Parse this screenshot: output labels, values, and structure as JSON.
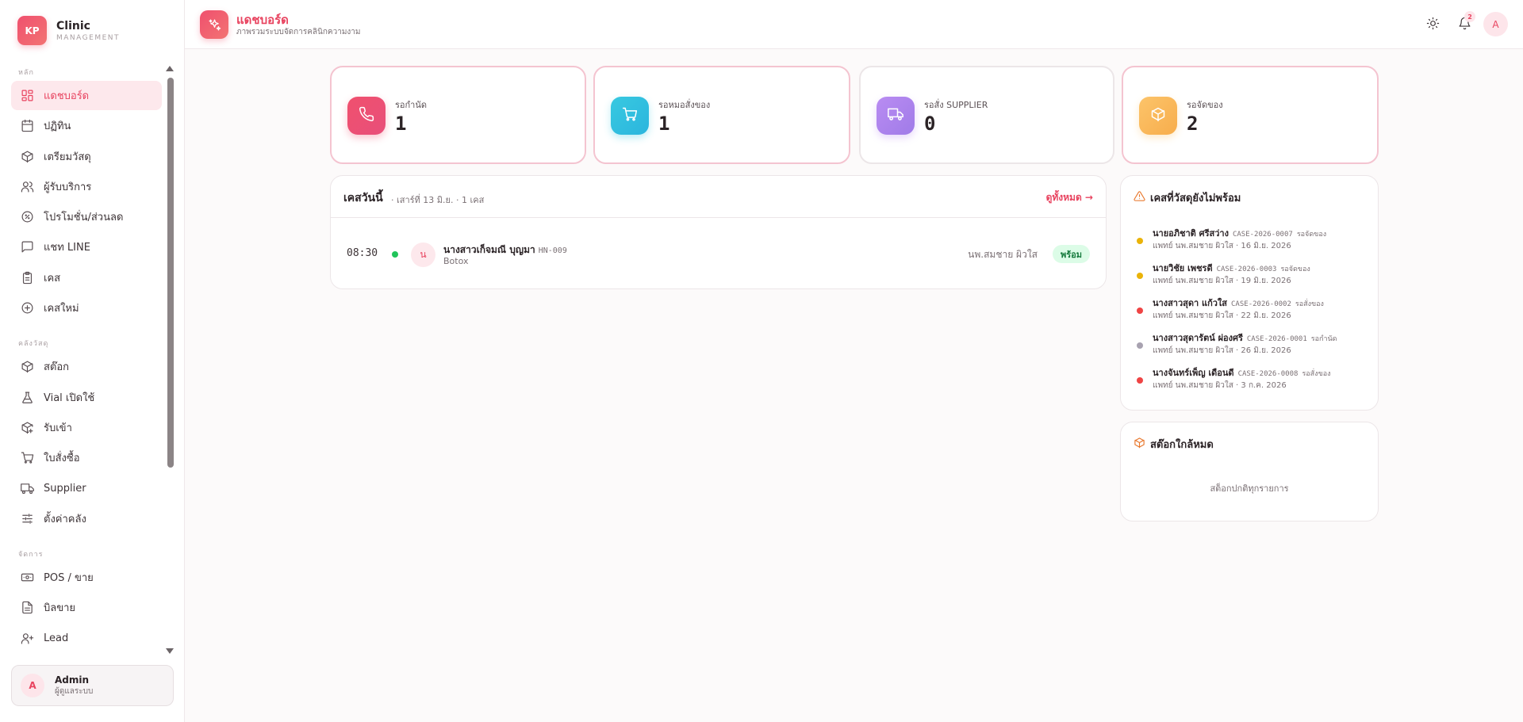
{
  "brand": {
    "logo": "KP",
    "name": "Clinic",
    "sub": "MANAGEMENT"
  },
  "nav": {
    "sections": [
      {
        "label": "หลัก",
        "items": [
          {
            "label": "แดชบอร์ด",
            "icon": "dashboard-icon",
            "active": true
          },
          {
            "label": "ปฏิทิน",
            "icon": "calendar-icon"
          },
          {
            "label": "เตรียมวัสดุ",
            "icon": "package-icon"
          },
          {
            "label": "ผู้รับบริการ",
            "icon": "users-icon"
          },
          {
            "label": "โปรโมชั่น/ส่วนลด",
            "icon": "percent-icon"
          },
          {
            "label": "แชท LINE",
            "icon": "chat-icon"
          },
          {
            "label": "เคส",
            "icon": "clipboard-icon"
          },
          {
            "label": "เคสใหม่",
            "icon": "plus-circle-icon"
          }
        ]
      },
      {
        "label": "คลังวัสดุ",
        "items": [
          {
            "label": "สต๊อก",
            "icon": "box-icon"
          },
          {
            "label": "Vial เปิดใช้",
            "icon": "flask-icon"
          },
          {
            "label": "รับเข้า",
            "icon": "package-plus-icon"
          },
          {
            "label": "ใบสั่งซื้อ",
            "icon": "cart-icon"
          },
          {
            "label": "Supplier",
            "icon": "truck-icon"
          },
          {
            "label": "ตั้งค่าคลัง",
            "icon": "sliders-icon"
          }
        ]
      },
      {
        "label": "จัดการ",
        "items": [
          {
            "label": "POS / ขาย",
            "icon": "cash-icon"
          },
          {
            "label": "บิลขาย",
            "icon": "receipt-icon"
          },
          {
            "label": "Lead",
            "icon": "user-plus-icon"
          }
        ]
      }
    ]
  },
  "user": {
    "initial": "A",
    "name": "Admin",
    "role": "ผู้ดูแลระบบ"
  },
  "header": {
    "title": "แดชบอร์ด",
    "subtitle": "ภาพรวมระบบจัดการคลินิกความงาม",
    "notif_count": "2",
    "avatar": "A"
  },
  "stats": [
    {
      "label": "รอกำนัด",
      "value": "1",
      "color_from": "#f0506e",
      "color_to": "#e84f7a",
      "icon": "phone-icon"
    },
    {
      "label": "รอหมอสั่งของ",
      "value": "1",
      "color_from": "#38c9e0",
      "color_to": "#2bb5de",
      "icon": "cart-icon"
    },
    {
      "label": "รอสั่ง SUPPLIER",
      "value": "0",
      "color_from": "#b98cf2",
      "color_to": "#a07be8",
      "icon": "truck-icon"
    },
    {
      "label": "รอจัดของ",
      "value": "2",
      "color_from": "#fcc46a",
      "color_to": "#f7ad4c",
      "icon": "package-icon"
    }
  ],
  "today": {
    "title": "เคสวันนี้",
    "meta": "· เสาร์ที่ 13 มิ.ย. · 1 เคส",
    "see_all": "ดูทั้งหมด →",
    "cases": [
      {
        "time": "08:30",
        "initial": "น",
        "name": "นางสาวเก็จมณี บุญมา",
        "hn": "HN-009",
        "procedure": "Botox",
        "doctor": "นพ.สมชาย ผิวใส",
        "status": "พร้อม"
      }
    ]
  },
  "pending": {
    "title": "เคสที่วัสดุยังไม่พร้อม",
    "items": [
      {
        "name": "นายอภิชาติ ศรีสว่าง",
        "code": "CASE-2026-0007",
        "status": "รอจัดของ",
        "detail": "แพทย์ นพ.สมชาย ผิวใส · 16 มิ.ย. 2026",
        "dot": "#eab308"
      },
      {
        "name": "นายวิชัย เพชรดี",
        "code": "CASE-2026-0003",
        "status": "รอจัดของ",
        "detail": "แพทย์ นพ.สมชาย ผิวใส · 19 มิ.ย. 2026",
        "dot": "#eab308"
      },
      {
        "name": "นางสาวสุดา แก้วใส",
        "code": "CASE-2026-0002",
        "status": "รอสั่งของ",
        "detail": "แพทย์ นพ.สมชาย ผิวใส · 22 มิ.ย. 2026",
        "dot": "#ef4444"
      },
      {
        "name": "นางสาวสุดารัตน์ ผ่องศรี",
        "code": "CASE-2026-0001",
        "status": "รอกำนัด",
        "detail": "แพทย์ นพ.สมชาย ผิวใส · 26 มิ.ย. 2026",
        "dot": "#a8a2b0"
      },
      {
        "name": "นางจันทร์เพ็ญ เดือนดี",
        "code": "CASE-2026-0008",
        "status": "รอสั่งของ",
        "detail": "แพทย์ นพ.สมชาย ผิวใส · 3 ก.ค. 2026",
        "dot": "#ef4444"
      }
    ]
  },
  "low_stock": {
    "title": "สต๊อกใกล้หมด",
    "empty": "สต็อกปกติทุกรายการ"
  }
}
